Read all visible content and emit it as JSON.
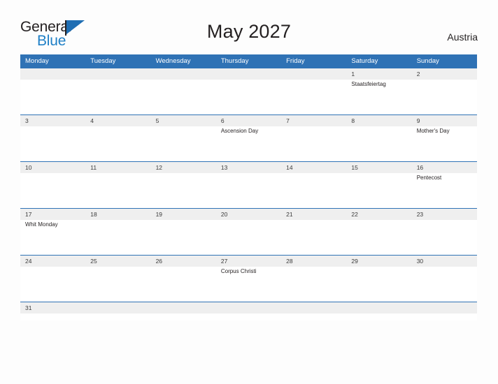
{
  "branding": {
    "logo_text_primary": "General",
    "logo_text_secondary": "Blue",
    "logo_flag_color": "#1f6eb3",
    "logo_secondary_color": "#1e7fc6"
  },
  "header": {
    "title": "May 2027",
    "country": "Austria"
  },
  "theme": {
    "header_blue": "#2f72b5",
    "daynum_band_gray": "#efefef",
    "page_background": "#fdfdfd",
    "text_color": "#231f20"
  },
  "calendar": {
    "month": "May",
    "year": "2027",
    "weekday_headers": [
      "Monday",
      "Tuesday",
      "Wednesday",
      "Thursday",
      "Friday",
      "Saturday",
      "Sunday"
    ],
    "weeks": [
      {
        "days": [
          {
            "number": "",
            "event": ""
          },
          {
            "number": "",
            "event": ""
          },
          {
            "number": "",
            "event": ""
          },
          {
            "number": "",
            "event": ""
          },
          {
            "number": "",
            "event": ""
          },
          {
            "number": "1",
            "event": "Staatsfeiertag"
          },
          {
            "number": "2",
            "event": ""
          }
        ]
      },
      {
        "days": [
          {
            "number": "3",
            "event": ""
          },
          {
            "number": "4",
            "event": ""
          },
          {
            "number": "5",
            "event": ""
          },
          {
            "number": "6",
            "event": "Ascension Day"
          },
          {
            "number": "7",
            "event": ""
          },
          {
            "number": "8",
            "event": ""
          },
          {
            "number": "9",
            "event": "Mother's Day"
          }
        ]
      },
      {
        "days": [
          {
            "number": "10",
            "event": ""
          },
          {
            "number": "11",
            "event": ""
          },
          {
            "number": "12",
            "event": ""
          },
          {
            "number": "13",
            "event": ""
          },
          {
            "number": "14",
            "event": ""
          },
          {
            "number": "15",
            "event": ""
          },
          {
            "number": "16",
            "event": "Pentecost"
          }
        ]
      },
      {
        "days": [
          {
            "number": "17",
            "event": "Whit Monday"
          },
          {
            "number": "18",
            "event": ""
          },
          {
            "number": "19",
            "event": ""
          },
          {
            "number": "20",
            "event": ""
          },
          {
            "number": "21",
            "event": ""
          },
          {
            "number": "22",
            "event": ""
          },
          {
            "number": "23",
            "event": ""
          }
        ]
      },
      {
        "days": [
          {
            "number": "24",
            "event": ""
          },
          {
            "number": "25",
            "event": ""
          },
          {
            "number": "26",
            "event": ""
          },
          {
            "number": "27",
            "event": "Corpus Christi"
          },
          {
            "number": "28",
            "event": ""
          },
          {
            "number": "29",
            "event": ""
          },
          {
            "number": "30",
            "event": ""
          }
        ]
      },
      {
        "days": [
          {
            "number": "31",
            "event": ""
          },
          {
            "number": "",
            "event": ""
          },
          {
            "number": "",
            "event": ""
          },
          {
            "number": "",
            "event": ""
          },
          {
            "number": "",
            "event": ""
          },
          {
            "number": "",
            "event": ""
          },
          {
            "number": "",
            "event": ""
          }
        ]
      }
    ]
  }
}
